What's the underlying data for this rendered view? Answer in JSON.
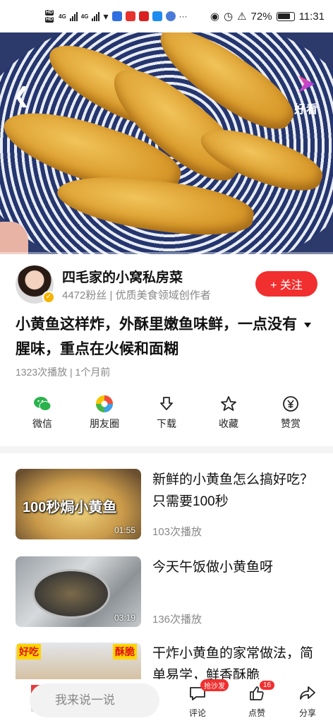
{
  "status_bar": {
    "hd_top": "HD",
    "hd_bottom": "HD",
    "network1": "4G",
    "network2": "4G",
    "battery_percent": "72%",
    "battery_level": 0.72,
    "time": "11:31"
  },
  "video": {
    "brand_label": "好看",
    "progress": 0.0
  },
  "author": {
    "name": "四毛家的小窝私房菜",
    "meta": "4472粉丝 | 优质美食领域创作者",
    "follow_label": "+ 关注"
  },
  "video_title": "小黄鱼这样炸，外酥里嫩鱼味鲜，一点没有腥味，重点在火候和面糊",
  "video_meta": "1323次播放 | 1个月前",
  "actions": [
    {
      "label": "微信",
      "icon": "wechat-icon"
    },
    {
      "label": "朋友圈",
      "icon": "moments-icon"
    },
    {
      "label": "下载",
      "icon": "download-icon"
    },
    {
      "label": "收藏",
      "icon": "star-icon"
    },
    {
      "label": "赞赏",
      "icon": "yen-icon"
    }
  ],
  "recommendations": [
    {
      "title": "新鲜的小黄鱼怎么搞好吃？只需要100秒",
      "plays": "103次播放",
      "duration": "01:55",
      "thumb_text": "100秒焗小黄鱼"
    },
    {
      "title": "今天午饭做小黄鱼呀",
      "plays": "136次播放",
      "duration": "03:19"
    },
    {
      "title": "干炸小黄鱼的家常做法，简单易学，鲜香酥脆",
      "plays": "",
      "duration": "",
      "thumb_left": "好吃",
      "thumb_right": "酥脆"
    }
  ],
  "bottom_bar": {
    "comment_placeholder": "我来说一说",
    "comment_label": "评论",
    "comment_badge": "抢沙发",
    "like_label": "点赞",
    "like_count": "16",
    "share_label": "分享"
  }
}
